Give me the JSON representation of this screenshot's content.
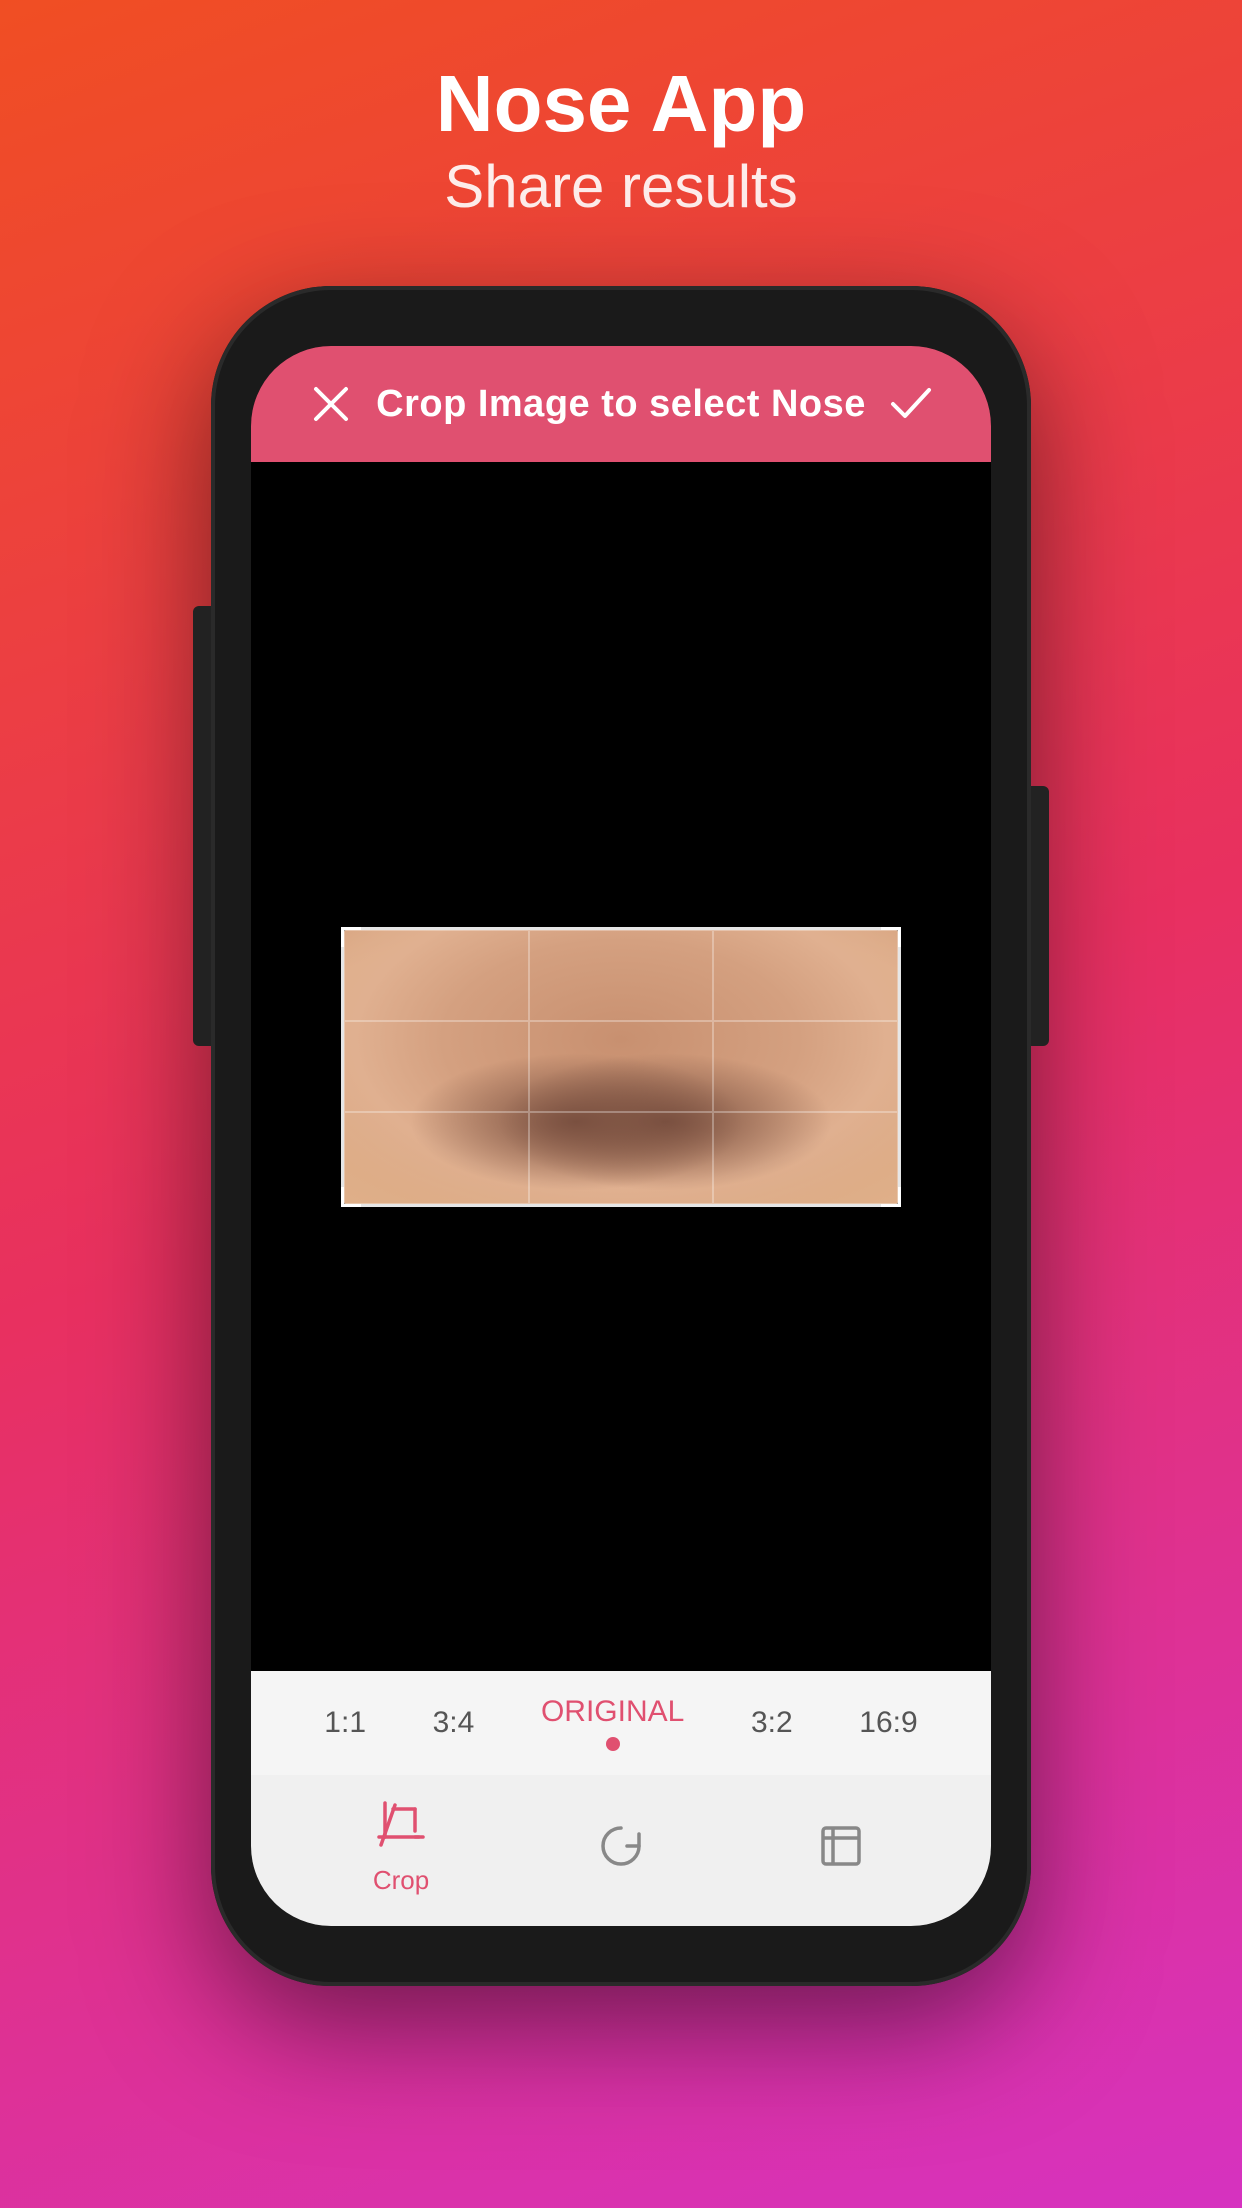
{
  "header": {
    "title": "Nose App",
    "subtitle": "Share results"
  },
  "crop_bar": {
    "title": "Crop Image to select Nose",
    "close_icon": "×",
    "confirm_icon": "✓",
    "background_color": "#e05070"
  },
  "ratio_bar": {
    "options": [
      {
        "label": "1:1",
        "active": false
      },
      {
        "label": "3:4",
        "active": false
      },
      {
        "label": "ORIGINAL",
        "active": true
      },
      {
        "label": "3:2",
        "active": false
      },
      {
        "label": "16:9",
        "active": false
      }
    ]
  },
  "toolbar": {
    "items": [
      {
        "label": "Crop",
        "icon": "crop-icon",
        "active": true
      },
      {
        "label": "",
        "icon": "rotate-icon",
        "active": false
      },
      {
        "label": "",
        "icon": "expand-icon",
        "active": false
      }
    ]
  }
}
